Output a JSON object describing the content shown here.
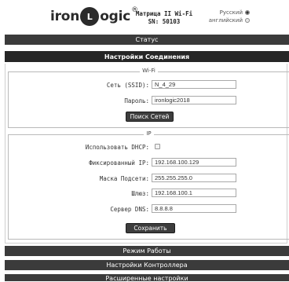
{
  "header": {
    "logo_left": "iron",
    "logo_mark": "L",
    "logo_right": "ogic",
    "logo_reg": "®",
    "device_title": "Матрица II Wi-Fi",
    "device_sn": "SN: 50103",
    "languages": [
      {
        "label": "Русский",
        "selected": true
      },
      {
        "label": "английский",
        "selected": false
      }
    ]
  },
  "menu": {
    "status": "Статус",
    "connection_settings": "Настройки Соединения",
    "work_mode": "Режим Работы",
    "controller_settings": "Настройки Контроллера",
    "advanced_settings": "Расширенные настройки"
  },
  "wifi": {
    "legend": "Wi-Fi",
    "ssid_label": "Сеть (SSID):",
    "ssid_value": "N_4_29",
    "password_label": "Пароль:",
    "password_value": "ironlogic2018",
    "scan_button": "Поиск Сетей"
  },
  "ip": {
    "legend": "IP",
    "dhcp_label": "Использовать DHCP:",
    "dhcp_checked": false,
    "fixed_ip_label": "Фиксированный IP:",
    "fixed_ip_value": "192.168.100.129",
    "mask_label": "Маска Подсети:",
    "mask_value": "255.255.255.0",
    "gateway_label": "Шлюз:",
    "gateway_value": "192.168.100.1",
    "dns_label": "Сервер DNS:",
    "dns_value": "8.8.8.8"
  },
  "actions": {
    "save_button": "Сохранить"
  }
}
